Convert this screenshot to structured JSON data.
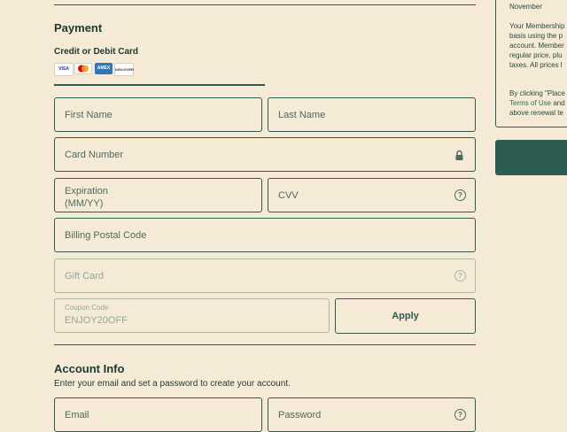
{
  "payment": {
    "heading": "Payment",
    "card_label": "Credit or Debit Card",
    "card_icons": [
      "VISA",
      "",
      "AMEX",
      "DISCOVER"
    ],
    "first_name": "First Name",
    "last_name": "Last Name",
    "card_number": "Card Number",
    "expiration_line1": "Expiration",
    "expiration_line2": "(MM/YY)",
    "cvv": "CVV",
    "billing_postal": "Billing Postal Code",
    "gift_card": "Gift Card",
    "coupon_label": "Coupon Code",
    "coupon_value": "ENJOY20OFF",
    "apply_label": "Apply"
  },
  "account": {
    "heading": "Account Info",
    "subtext": "Enter your email and set a password to create your account.",
    "email": "Email",
    "password": "Password"
  },
  "sidebar": {
    "month": "November",
    "terms_lines": [
      "Your Membership",
      "basis using the p",
      "account. Member",
      "regular price, plu",
      "taxes. All prices l"
    ],
    "click_line1": "By clicking \"Place",
    "click_link": "Terms of Use",
    "click_line2_rest": " and",
    "click_line3": "above renewal te"
  },
  "colors": {
    "background": "#f4ead6",
    "accent": "#2f5c4f",
    "button": "#2d5c50"
  }
}
